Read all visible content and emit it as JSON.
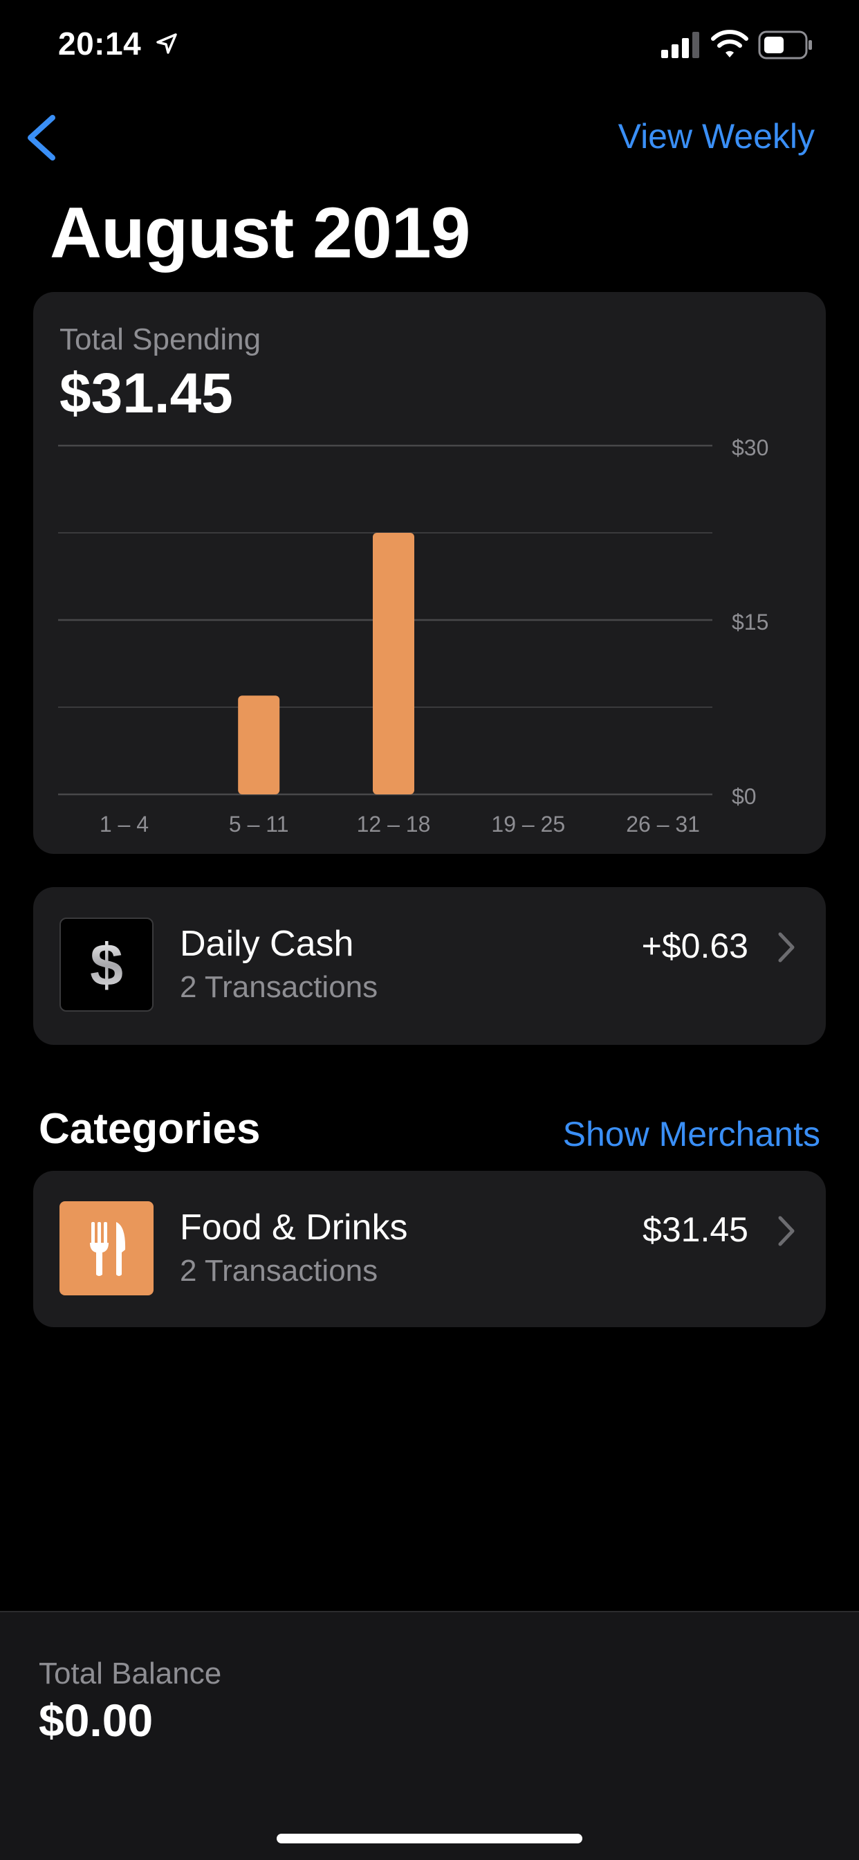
{
  "status_bar": {
    "time": "20:14",
    "icons": [
      "location-arrow-icon",
      "cellular-signal-icon",
      "wifi-icon",
      "battery-icon"
    ]
  },
  "nav": {
    "back_icon": "chevron-left-icon",
    "view_weekly": "View Weekly"
  },
  "title": "August 2019",
  "spending": {
    "label": "Total Spending",
    "value": "$31.45"
  },
  "chart_data": {
    "type": "bar",
    "categories": [
      "1 – 4",
      "5 – 11",
      "12 – 18",
      "19 – 25",
      "26 – 31"
    ],
    "values": [
      0,
      8.5,
      22.5,
      0,
      0
    ],
    "ylim": [
      0,
      30
    ],
    "yticks": [
      {
        "value": 30,
        "label": "$30"
      },
      {
        "value": 15,
        "label": "$15"
      },
      {
        "value": 0,
        "label": "$0"
      }
    ],
    "gridlines": [
      0,
      7.5,
      15,
      22.5,
      30
    ],
    "bar_color": "#e9975a",
    "grid": true
  },
  "daily_cash": {
    "icon": "dollar-sign-icon",
    "title": "Daily Cash",
    "subtitle": "2 Transactions",
    "amount": "+$0.63"
  },
  "categories": {
    "title": "Categories",
    "show_merchants": "Show Merchants",
    "items": [
      {
        "icon": "fork-knife-icon",
        "title": "Food & Drinks",
        "subtitle": "2 Transactions",
        "amount": "$31.45"
      }
    ]
  },
  "balance": {
    "label": "Total Balance",
    "value": "$0.00"
  },
  "colors": {
    "accent": "#3a8ff6",
    "bar": "#e9975a",
    "card": "#1c1c1e",
    "secondary_text": "#8e8e93"
  }
}
